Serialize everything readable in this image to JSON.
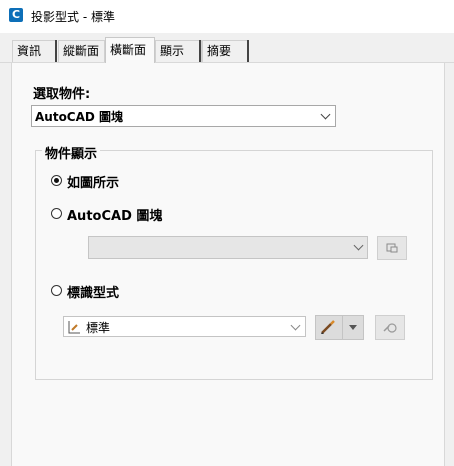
{
  "window": {
    "title": "投影型式 - 標準",
    "app_icon_letter": "C"
  },
  "tabs": [
    {
      "label": "資訊",
      "active": false
    },
    {
      "label": "縱斷面",
      "active": false
    },
    {
      "label": "橫斷面",
      "active": true
    },
    {
      "label": "顯示",
      "active": false
    },
    {
      "label": "摘要",
      "active": false
    }
  ],
  "select_object": {
    "label": "選取物件:",
    "value": "AutoCAD 圖塊"
  },
  "object_display": {
    "group_title": "物件顯示",
    "options": [
      {
        "label": "如圖所示",
        "selected": true
      },
      {
        "label": "AutoCAD 圖塊",
        "selected": false
      },
      {
        "label": "標識型式",
        "selected": false
      }
    ],
    "block_combo_value": "",
    "marker_style_value": "標準"
  },
  "icons": {
    "app": "civil3d-icon",
    "block_pick": "pick-block-icon",
    "marker_icon": "marker-style-icon",
    "edit": "edit-style-icon",
    "dropdown": "chevron-down-icon",
    "preview": "preview-icon"
  }
}
